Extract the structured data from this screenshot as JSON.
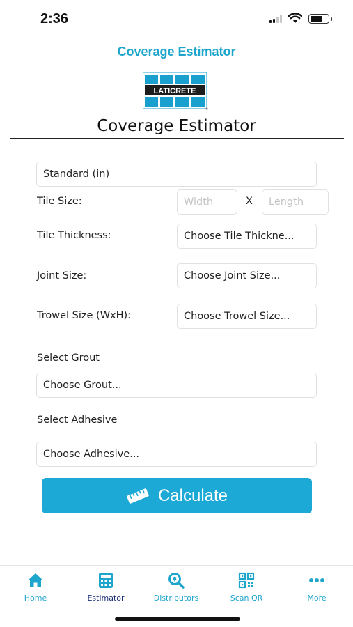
{
  "status_bar": {
    "time": "2:36"
  },
  "header": {
    "title": "Coverage Estimator"
  },
  "logo": {
    "text": "LATICRETE"
  },
  "page": {
    "heading": "Coverage Estimator"
  },
  "form": {
    "unit_select": {
      "value": "Standard (in)"
    },
    "tile_size": {
      "label": "Tile Size:",
      "width_placeholder": "Width",
      "separator": "X",
      "length_placeholder": "Length"
    },
    "tile_thickness": {
      "label": "Tile Thickness:",
      "value": "Choose Tile Thickne..."
    },
    "joint_size": {
      "label": "Joint Size:",
      "value": "Choose Joint Size..."
    },
    "trowel_size": {
      "label": "Trowel Size (WxH):",
      "value": "Choose Trowel Size..."
    },
    "grout": {
      "label": "Select Grout",
      "value": "Choose Grout..."
    },
    "adhesive": {
      "label": "Select Adhesive",
      "value": "Choose Adhesive..."
    },
    "calculate_label": "Calculate"
  },
  "tab_bar": {
    "tabs": [
      {
        "label": "Home",
        "icon": "home-icon"
      },
      {
        "label": "Estimator",
        "icon": "calculator-icon",
        "active": true
      },
      {
        "label": "Distributors",
        "icon": "search-location-icon"
      },
      {
        "label": "Scan QR",
        "icon": "qr-code-icon"
      },
      {
        "label": "More",
        "icon": "more-dots-icon"
      }
    ]
  },
  "colors": {
    "accent": "#1da5cc",
    "button": "#1ca9d6",
    "active_tab": "#1b2f75",
    "logo_blue": "#1aa0cf"
  }
}
